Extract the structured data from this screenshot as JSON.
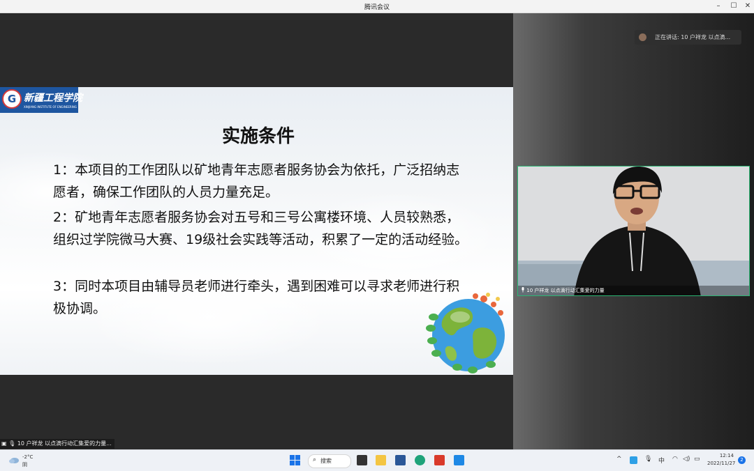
{
  "window": {
    "title": "腾讯会议",
    "min": "–",
    "max": "☐",
    "close": "✕"
  },
  "speaking": {
    "label": "正在讲话: 10  户祥龙  以点滴..."
  },
  "logo": {
    "cn": "新疆工程学院",
    "en": "XINJIANG INSTITUTE OF ENGINEERING"
  },
  "slide": {
    "title": "实施条件",
    "paragraphs": [
      "1：本项目的工作团队以矿地青年志愿者服务协会为依托，广泛招纳志愿者，确保工作团队的人员力量充足。",
      "2：矿地青年志愿者服务协会对五号和三号公寓楼环境、人员较熟悉，组织过学院微马大赛、19级社会实践等活动，积累了一定的活动经验。",
      "3：同时本项目由辅导员老师进行牵头，遇到困难可以寻求老师进行积极协调。"
    ]
  },
  "camera": {
    "caption": "10  户祥龙  以点滴行动汇集爱的力量"
  },
  "speaker_caption": "10  户祥龙  以点滴行动汇集爱的力量...",
  "taskbar": {
    "temp": "-2°C",
    "condition": "阴",
    "search": "搜索",
    "tray": {
      "chevron": "^",
      "ime": "中"
    },
    "time": "12:14",
    "date": "2022/11/27",
    "notifications": "2"
  },
  "colors": {
    "accent_green": "#2bb673",
    "logo_blue": "#1e56a0"
  }
}
